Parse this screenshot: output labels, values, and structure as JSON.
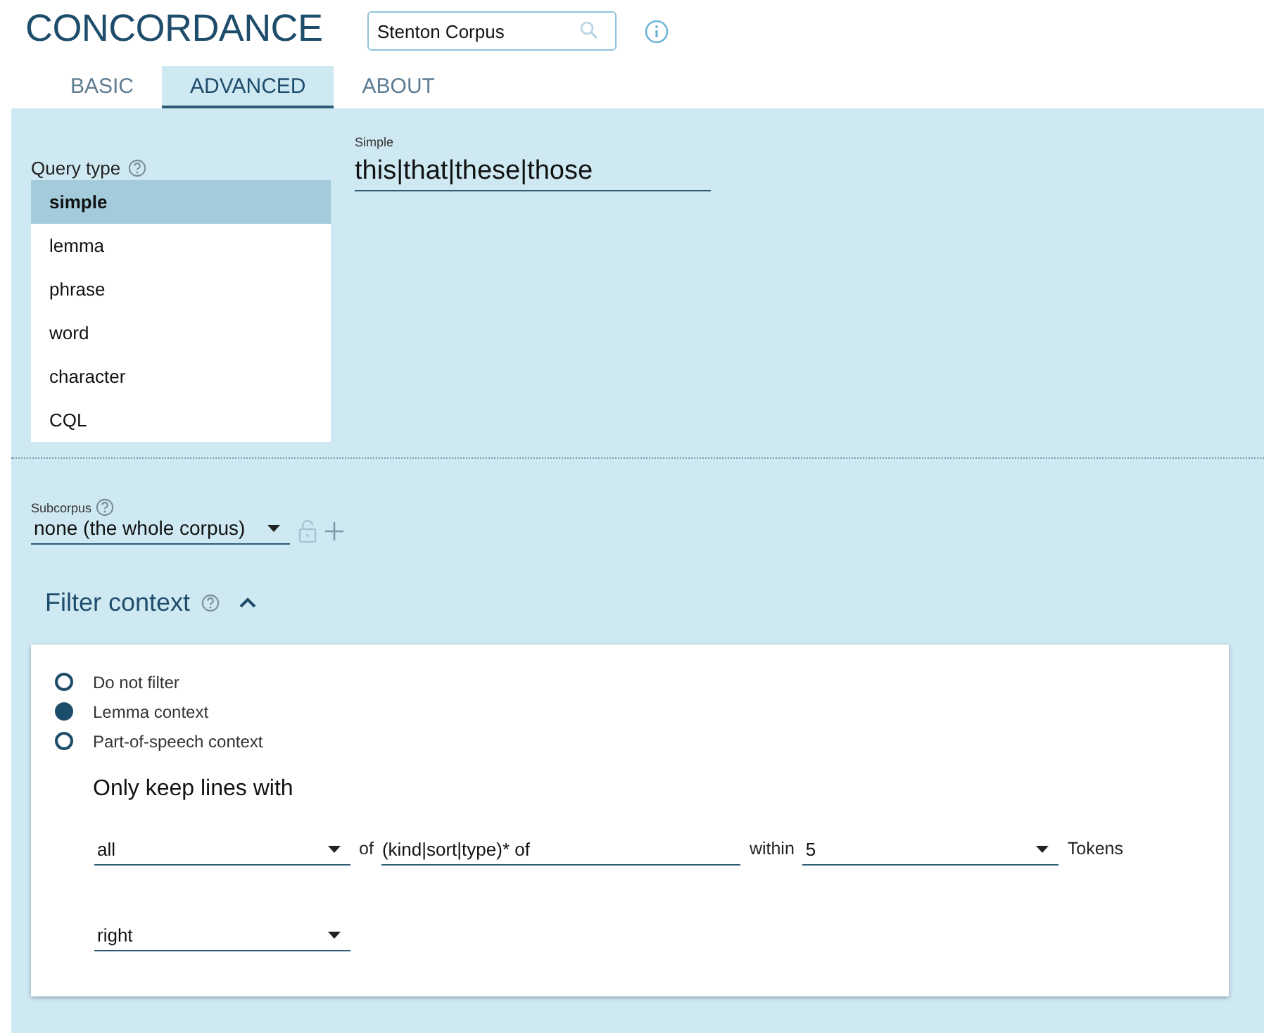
{
  "header": {
    "title": "CONCORDANCE",
    "corpus_field": {
      "value": "Stenton Corpus"
    }
  },
  "tabs": [
    {
      "label": "BASIC",
      "selected": false
    },
    {
      "label": "ADVANCED",
      "selected": true
    },
    {
      "label": "ABOUT",
      "selected": false
    }
  ],
  "query_type": {
    "label": "Query type",
    "items": [
      {
        "label": "simple",
        "selected": true
      },
      {
        "label": "lemma",
        "selected": false
      },
      {
        "label": "phrase",
        "selected": false
      },
      {
        "label": "word",
        "selected": false
      },
      {
        "label": "character",
        "selected": false
      },
      {
        "label": "CQL",
        "selected": false
      }
    ]
  },
  "query": {
    "label": "Simple",
    "value": "this|that|these|those"
  },
  "subcorpus": {
    "label": "Subcorpus",
    "value": "none (the whole corpus)"
  },
  "filter_context": {
    "title": "Filter context",
    "expanded": true,
    "options": [
      {
        "label": "Do not filter",
        "selected": false
      },
      {
        "label": "Lemma context",
        "selected": true
      },
      {
        "label": "Part-of-speech context",
        "selected": false
      }
    ],
    "heading": "Only keep lines with",
    "rows": [
      [
        {
          "kind": "select",
          "value": "all"
        },
        {
          "kind": "text",
          "value": "of"
        },
        {
          "kind": "input",
          "value": "(kind|sort|type)* of"
        },
        {
          "kind": "text",
          "value": "within"
        },
        {
          "kind": "select",
          "value": "5"
        },
        {
          "kind": "text",
          "value": "Tokens"
        }
      ],
      [
        {
          "kind": "select",
          "value": "right"
        }
      ]
    ]
  }
}
